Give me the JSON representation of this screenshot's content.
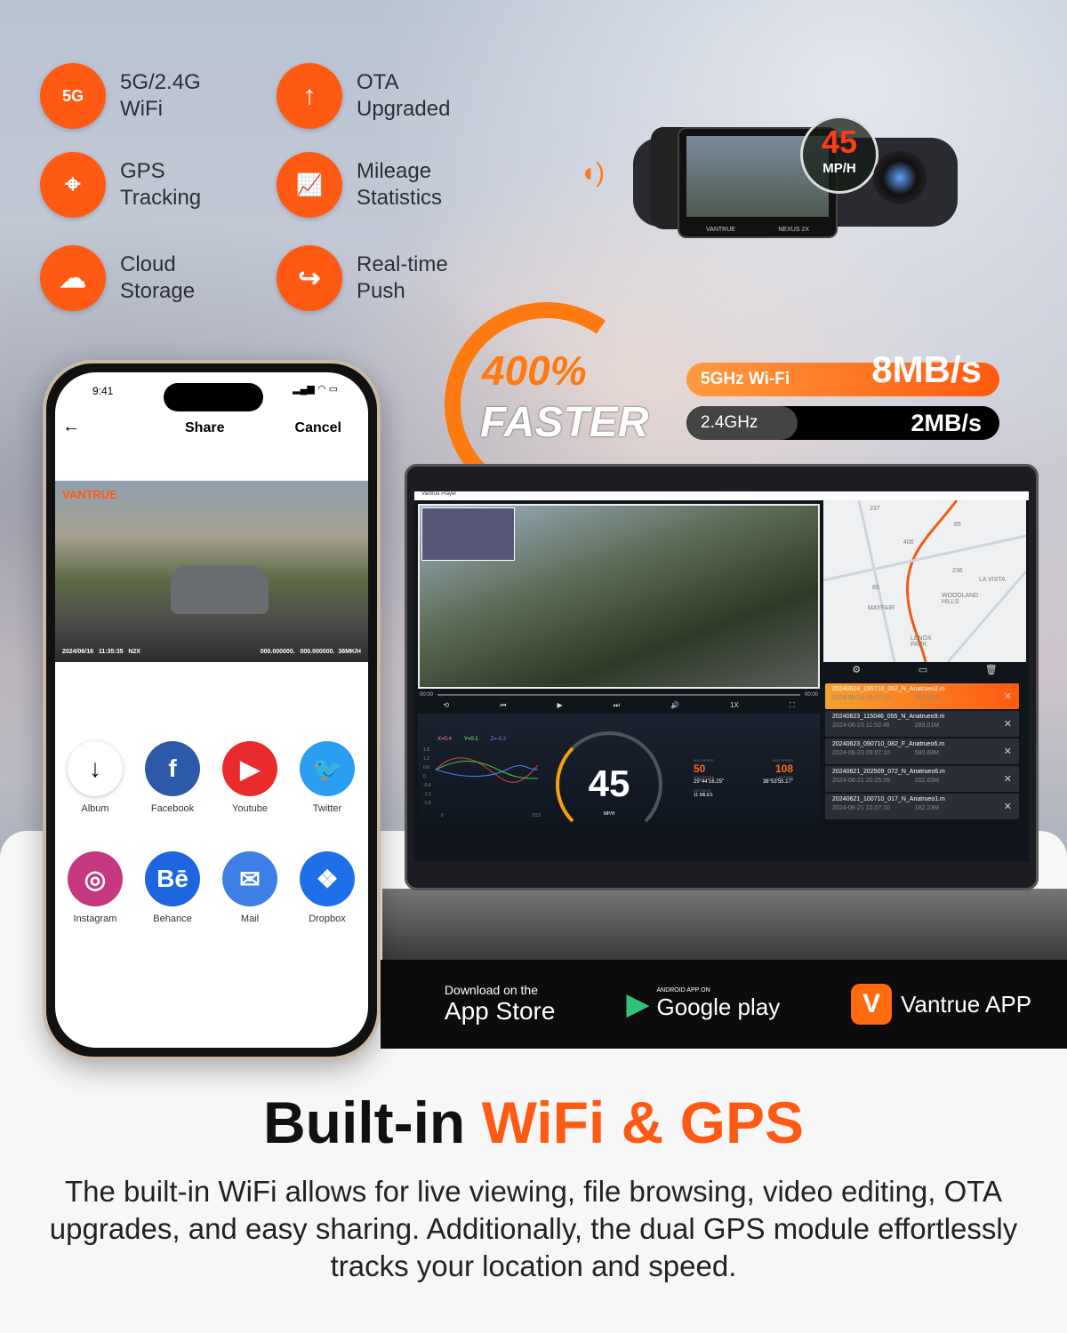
{
  "features": [
    {
      "icon": "wifi-5g-icon",
      "glyph": "5G",
      "label": "5G/2.4G\nWiFi"
    },
    {
      "icon": "upload-arrow-icon",
      "glyph": "↑",
      "label": "OTA\nUpgraded"
    },
    {
      "icon": "location-pin-icon",
      "glyph": "⌖",
      "label": "GPS\nTracking"
    },
    {
      "icon": "chart-document-icon",
      "glyph": "📈",
      "label": "Mileage\nStatistics"
    },
    {
      "icon": "cloud-upload-icon",
      "glyph": "☁",
      "label": "Cloud\nStorage"
    },
    {
      "icon": "share-arrow-icon",
      "glyph": "↪",
      "label": "Real-time\nPush"
    }
  ],
  "dashcam": {
    "speed": "45",
    "unit": "MP/H",
    "brand": "VANTRUE",
    "model": "NEXUS 2X"
  },
  "speed_badge": {
    "percent": "400%",
    "word": "FASTER"
  },
  "wifi_speeds": [
    {
      "band": "5GHz Wi-Fi",
      "speed": "8MB/s",
      "color": "#ff6a10"
    },
    {
      "band": "2.4GHz",
      "speed": "2MB/s",
      "color": "#000000"
    }
  ],
  "phone": {
    "time": "9:41",
    "nav_title": "Share",
    "cancel": "Cancel",
    "back": "←",
    "video_brand": "VANTRUE",
    "overlay_left": "2024/06/16   11:35:35   N2X",
    "overlay_right": "000.000000.   000.000000.  36MK/H",
    "share_targets": [
      {
        "label": "Album",
        "icon": "download-icon",
        "glyph": "↓",
        "color": "#ffffff"
      },
      {
        "label": "Facebook",
        "icon": "facebook-icon",
        "glyph": "f",
        "color": "#2d5aa8"
      },
      {
        "label": "Youtube",
        "icon": "youtube-icon",
        "glyph": "▶",
        "color": "#ea2b2b"
      },
      {
        "label": "Twitter",
        "icon": "twitter-icon",
        "glyph": "🐦",
        "color": "#2a9ef0"
      },
      {
        "label": "Instagram",
        "icon": "instagram-icon",
        "glyph": "◎",
        "color": "#c6387f"
      },
      {
        "label": "Behance",
        "icon": "behance-icon",
        "glyph": "Bē",
        "color": "#1d66e0"
      },
      {
        "label": "Mail",
        "icon": "mail-icon",
        "glyph": "✉",
        "color": "#3d7fe6"
      },
      {
        "label": "Dropbox",
        "icon": "dropbox-icon",
        "glyph": "❖",
        "color": "#1f70e8"
      }
    ]
  },
  "laptop": {
    "app_title": "Vantrue Player",
    "time_start": "00:00",
    "time_end": "00:00",
    "playback_rate": "1X",
    "map_labels": [
      "237",
      "400",
      "85",
      "236",
      "LA VISTA",
      "WOODLAND HILLS",
      "MAYFAIR",
      "LENOX PARK",
      "85"
    ],
    "gsensor": {
      "x": "X=0.4",
      "y": "Y=0.1",
      "z": "Z=-0.2",
      "yticks": [
        "1.8",
        "1.2",
        "0.6",
        "0",
        "-0.6",
        "-1.2",
        "-1.8"
      ],
      "x_start": "0",
      "x_end": "3:53"
    },
    "speed": "45",
    "speed_unit": "MP/H",
    "avg_speed_label": "AVG SPEED",
    "avg_speed": "50",
    "max_speed_label": "MAX SPEED",
    "max_speed": "108",
    "longitude_label": "LONGITUDE",
    "longitude": "29°44'16.25\"",
    "latitude_label": "LATITUDE",
    "latitude": "38°53'55.17\"",
    "distance_label": "DISTANCE",
    "distance": "11 MILES",
    "files": [
      {
        "name": "20240624_195710_052_N_Anatrueo2.m",
        "date": "2024-06-24 19:57:10",
        "size": "482.68M",
        "selected": true
      },
      {
        "name": "20240623_115046_055_N_Anatrueo9.m",
        "date": "2024-06-23 11:50:46",
        "size": "289.01M"
      },
      {
        "name": "20240623_090710_082_F_Anatrueo6.m",
        "date": "2024-06-23 09:07:10",
        "size": "580.69M"
      },
      {
        "name": "20240621_202509_072_N_Anatrueo6.m",
        "date": "2024-06-21 20:25:09",
        "size": "202.65M"
      },
      {
        "name": "20240621_100710_017_N_Anatrueo1.m",
        "date": "2024-06-21 10:07:10",
        "size": "182.23M"
      }
    ]
  },
  "stores": {
    "apple_small": "Download on the",
    "apple_big": "App Store",
    "google_small": "ANDROID APP ON",
    "google_big": "Google play",
    "vantrue": "Vantrue APP"
  },
  "headline": {
    "part1": "Built-in ",
    "part2": "WiFi & GPS",
    "accent": "#ff5a14"
  },
  "description": "The built-in WiFi allows for live viewing, file browsing, video editing, OTA upgrades, and easy sharing. Additionally, the dual GPS module effortlessly tracks your location and speed."
}
